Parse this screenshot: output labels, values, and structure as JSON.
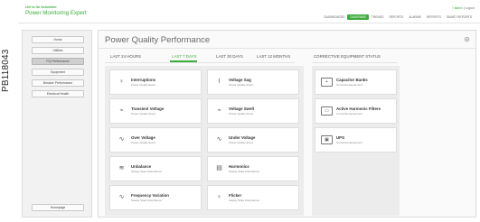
{
  "side_label": "PB118043",
  "brand": {
    "company": "Life Is On Schneider",
    "app": "Power Monitoring Expert"
  },
  "user_links": {
    "user": "admin",
    "separator": "|",
    "logout": "Logout",
    "help": "?"
  },
  "top_nav": [
    "DASHBOARDS",
    "DIAGRAMS",
    "TRENDS",
    "REPORTS",
    "ALARMS",
    "REPORTS",
    "SMART REPORTS"
  ],
  "top_nav_active_index": 1,
  "menu": {
    "items": [
      "Home",
      "Utilities",
      "PQ Performance",
      "Equipment",
      "Breaker Performance",
      "Electrical Health"
    ],
    "selected_index": 2,
    "footer": "Homepage"
  },
  "main": {
    "title": "Power Quality Performance",
    "tabs": [
      "LAST 24 HOURS",
      "LAST 7 DAYS",
      "LAST 30 DAYS",
      "LAST 12 MONTHS"
    ],
    "active_tab_index": 1,
    "corrective_heading": "CORRECTIVE EQUIPMENT STATUS"
  },
  "cards": [
    {
      "title": "Interruptions",
      "subtitle": "Power Quality Event",
      "icon": "interruption-icon",
      "glyph": "♀"
    },
    {
      "title": "Voltage Sag",
      "subtitle": "Power Quality Event",
      "icon": "voltage-sag-icon",
      "glyph": "⌇"
    },
    {
      "title": "Transient Voltage",
      "subtitle": "Power Quality Event",
      "icon": "transient-icon",
      "glyph": "⌁"
    },
    {
      "title": "Voltage Swell",
      "subtitle": "Power Quality Event",
      "icon": "voltage-swell-icon",
      "glyph": "⌁"
    },
    {
      "title": "Over Voltage",
      "subtitle": "Power Quality Event",
      "icon": "over-voltage-icon",
      "glyph": "∿"
    },
    {
      "title": "Under Voltage",
      "subtitle": "Power Quality Event",
      "icon": "under-voltage-icon",
      "glyph": "∿"
    },
    {
      "title": "Unbalance",
      "subtitle": "Steady State Disturbance",
      "icon": "unbalance-icon",
      "glyph": "≋"
    },
    {
      "title": "Harmonics",
      "subtitle": "Steady State Disturbance",
      "icon": "harmonics-icon",
      "glyph": "▤"
    },
    {
      "title": "Frequency Variation",
      "subtitle": "Steady State Disturbance",
      "icon": "frequency-icon",
      "glyph": "∿"
    },
    {
      "title": "Flicker",
      "subtitle": "Steady State Disturbance",
      "icon": "flicker-icon",
      "glyph": "♀"
    }
  ],
  "corrective": [
    {
      "title": "Capacitor Banks",
      "subtitle": "Corrective Equipment",
      "icon": "capacitor-icon",
      "glyph": "+"
    },
    {
      "title": "Active Harmonic Filters",
      "subtitle": "Corrective Equipment",
      "icon": "filter-icon",
      "glyph": "▭"
    },
    {
      "title": "UPS",
      "subtitle": "Corrective Equipment",
      "icon": "ups-icon",
      "glyph": "▣"
    }
  ],
  "colors": {
    "accent": "#3dac3d",
    "panel": "#ececec",
    "card": "#ffffff"
  }
}
